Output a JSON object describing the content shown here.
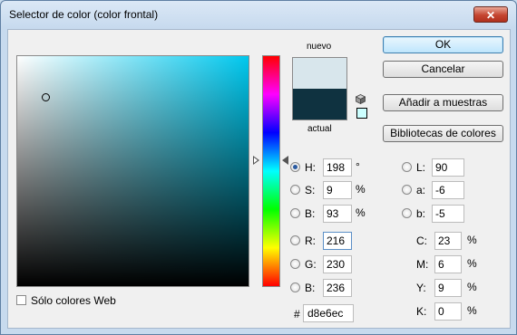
{
  "window": {
    "title": "Selector de color (color frontal)",
    "close_label": "✕"
  },
  "preview": {
    "new_label": "nuevo",
    "current_label": "actual",
    "new_color": "#d8e6ec",
    "current_color": "#0f3240"
  },
  "buttons": {
    "ok": "OK",
    "cancel": "Cancelar",
    "add_to_swatches": "Añadir a muestras",
    "color_libraries": "Bibliotecas de colores"
  },
  "hsb": {
    "h": {
      "label": "H:",
      "value": "198",
      "unit": "°",
      "selected": true
    },
    "s": {
      "label": "S:",
      "value": "9",
      "unit": "%"
    },
    "b": {
      "label": "B:",
      "value": "93",
      "unit": "%"
    }
  },
  "rgb": {
    "r": {
      "label": "R:",
      "value": "216"
    },
    "g": {
      "label": "G:",
      "value": "230"
    },
    "b": {
      "label": "B:",
      "value": "236"
    }
  },
  "lab": {
    "l": {
      "label": "L:",
      "value": "90"
    },
    "a": {
      "label": "a:",
      "value": "-6"
    },
    "b": {
      "label": "b:",
      "value": "-5"
    }
  },
  "cmyk": {
    "c": {
      "label": "C:",
      "value": "23",
      "unit": "%"
    },
    "m": {
      "label": "M:",
      "value": "6",
      "unit": "%"
    },
    "y": {
      "label": "Y:",
      "value": "9",
      "unit": "%"
    },
    "k": {
      "label": "K:",
      "value": "0",
      "unit": "%"
    }
  },
  "web_only": {
    "label": "Sólo colores Web",
    "checked": false
  },
  "hex": {
    "prefix": "#",
    "value": "d8e6ec"
  }
}
